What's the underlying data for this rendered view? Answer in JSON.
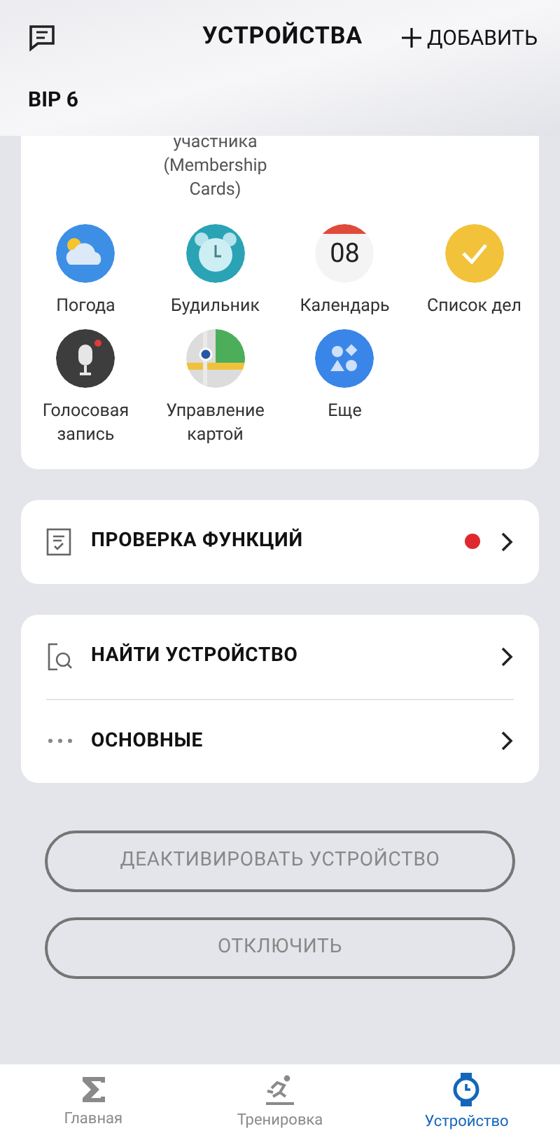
{
  "header": {
    "title": "УСТРОЙСТВА",
    "add_label": "ДОБАВИТЬ",
    "device_name": "BIP 6"
  },
  "apps_partial_label": "участника (Membership Cards)",
  "apps": [
    {
      "kind": "weather",
      "label": "Погода"
    },
    {
      "kind": "alarm",
      "label": "Будильник"
    },
    {
      "kind": "calendar",
      "label": "Календарь",
      "day": "08"
    },
    {
      "kind": "todo",
      "label": "Список дел"
    },
    {
      "kind": "voice",
      "label": "Голосовая запись"
    },
    {
      "kind": "map",
      "label": "Управление картой"
    },
    {
      "kind": "more",
      "label": "Еще"
    }
  ],
  "check_row": {
    "label": "ПРОВЕРКА ФУНКЦИЙ",
    "alert": true
  },
  "menu": [
    {
      "kind": "find",
      "label": "НАЙТИ УСТРОЙСТВО"
    },
    {
      "kind": "general",
      "label": "ОСНОВНЫЕ"
    }
  ],
  "buttons": [
    "ДЕАКТИВИРОВАТЬ УСТРОЙСТВО",
    "ОТКЛЮЧИТЬ"
  ],
  "nav": [
    {
      "kind": "home",
      "label": "Главная",
      "selected": false
    },
    {
      "kind": "workout",
      "label": "Тренировка",
      "selected": false
    },
    {
      "kind": "device",
      "label": "Устройство",
      "selected": true
    }
  ]
}
